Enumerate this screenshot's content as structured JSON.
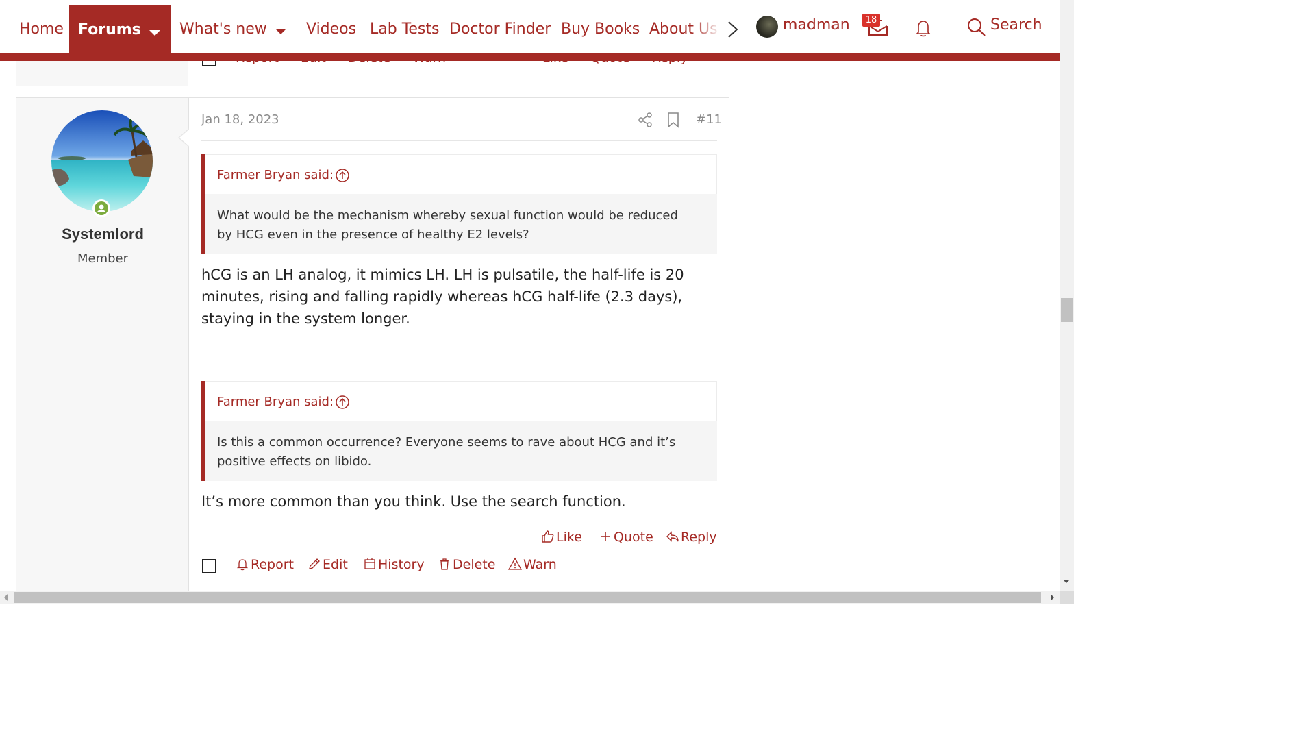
{
  "nav": {
    "home": "Home",
    "forums": "Forums",
    "whats_new": "What's new",
    "videos": "Videos",
    "lab_tests": "Lab Tests",
    "doctor_finder": "Doctor Finder",
    "buy_books": "Buy Books",
    "about_us": "About Us",
    "username": "madman",
    "inbox_count": "18",
    "search_label": "Search",
    "accent_color": "#a52a25"
  },
  "previous_post": {
    "actions_left": [
      "Report",
      "Edit",
      "Delete",
      "Warn"
    ],
    "actions_right": [
      "Like",
      "Quote",
      "Reply"
    ]
  },
  "post": {
    "author": "Systemlord",
    "user_title": "Member",
    "online": true,
    "date": "Jan 18, 2023",
    "number": "#11",
    "quotes": [
      {
        "author_said": "Farmer Bryan said:",
        "text": "What would be the mechanism whereby sexual function would be reduced by HCG even in the presence of healthy E2 levels?"
      },
      {
        "author_said": "Farmer Bryan said:",
        "text": "Is this a common occurrence? Everyone seems to rave about HCG and it’s positive effects on libido."
      }
    ],
    "replies": [
      "hCG is an LH analog, it mimics LH. LH is pulsatile, the half-life is 20 minutes, rising and falling rapidly whereas hCG half-life (2.3 days), staying in the system longer.",
      "It’s more common than you think. Use the search function."
    ],
    "actions": {
      "like": "Like",
      "quote": "Quote",
      "reply": "Reply",
      "report": "Report",
      "edit": "Edit",
      "history": "History",
      "delete": "Delete",
      "warn": "Warn"
    }
  }
}
